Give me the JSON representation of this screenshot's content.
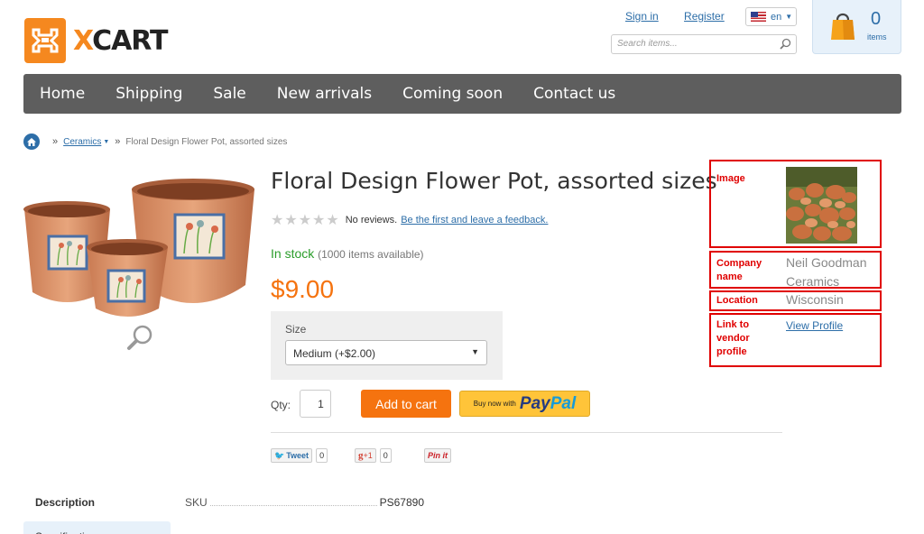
{
  "header": {
    "logo_text_x": "X",
    "logo_text_rest": "CART",
    "sign_in": "Sign in",
    "register": "Register",
    "lang": "en",
    "search_placeholder": "Search items...",
    "cart_count": "0",
    "cart_label": "items"
  },
  "nav": {
    "items": [
      "Home",
      "Shipping",
      "Sale",
      "New arrivals",
      "Coming soon",
      "Contact us"
    ]
  },
  "breadcrumb": {
    "category": "Ceramics",
    "current": "Floral Design Flower Pot, assorted sizes"
  },
  "product": {
    "title": "Floral Design Flower Pot, assorted sizes",
    "reviews_text": "No reviews.",
    "reviews_link": "Be the first and leave a feedback.",
    "stock": "In stock",
    "availability": "(1000 items available)",
    "price": "$9.00",
    "size_label": "Size",
    "size_selected": "Medium (+$2.00)",
    "qty_label": "Qty:",
    "qty_value": "1",
    "add_to_cart": "Add to cart",
    "paypal_small": "Buy now with",
    "paypal_pay": "Pay",
    "paypal_pal": "Pal"
  },
  "social": {
    "tweet": "Tweet",
    "tweet_count": "0",
    "gplus": "+1",
    "gplus_count": "0",
    "pinit": "Pin it"
  },
  "tabs": {
    "description": "Description",
    "specification": "Specification"
  },
  "sku": {
    "label": "SKU",
    "value": "PS67890"
  },
  "vendor": {
    "image_label": "Image",
    "company_label": "Company name",
    "company_value": "Neil Goodman Ceramics",
    "location_label": "Location",
    "location_value": "Wisconsin",
    "link_label": "Link to vendor profile",
    "link_value": "View Profile"
  },
  "colors": {
    "accent_orange": "#f5730f",
    "link_blue": "#2d6ea8",
    "nav_gray": "#5e5e5e",
    "annotation_red": "#e00000",
    "stock_green": "#2a9d2a"
  }
}
